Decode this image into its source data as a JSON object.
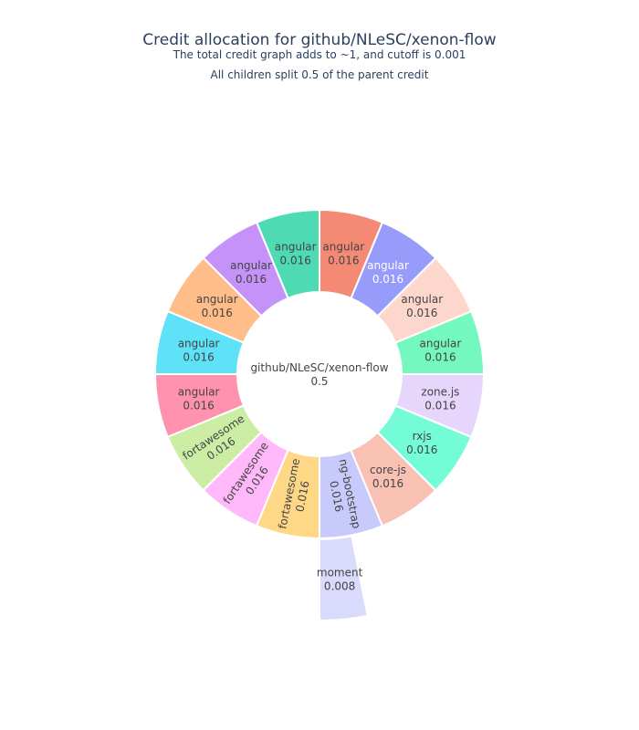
{
  "chart_data": {
    "type": "sunburst",
    "title": "Credit allocation for github/NLeSC/xenon-flow",
    "subtitle_lines": [
      "The total credit graph adds to ~1, and cutoff is 0.001",
      "All children split 0.5 of the parent credit"
    ],
    "root": {
      "label": "github/NLeSC/xenon-flow",
      "value": "0.5"
    },
    "children": [
      {
        "label": "angular",
        "value": "0.016",
        "color": "#F48A74"
      },
      {
        "label": "angular",
        "value": "0.016",
        "color": "#979BF9",
        "text_color": "#ffffff"
      },
      {
        "label": "angular",
        "value": "0.016",
        "color": "#FDD7CC"
      },
      {
        "label": "angular",
        "value": "0.016",
        "color": "#75F7C0"
      },
      {
        "label": "zone.js",
        "value": "0.016",
        "color": "#E7D6FB"
      },
      {
        "label": "rxjs",
        "value": "0.016",
        "color": "#74FCD7"
      },
      {
        "label": "core-js",
        "value": "0.016",
        "color": "#F9C0B4"
      },
      {
        "label": "ng-bootstrap",
        "value": "0.016",
        "color": "#C8CAFB",
        "rotate": true,
        "children": [
          {
            "label": "moment",
            "value": "0.008",
            "color": "#D9DAFC"
          }
        ]
      },
      {
        "label": "fortawesome",
        "value": "0.016",
        "color": "#FED886",
        "rotate": true
      },
      {
        "label": "fortawesome",
        "value": "0.016",
        "color": "#FFB8FA",
        "rotate": true
      },
      {
        "label": "fortawesome",
        "value": "0.016",
        "color": "#CBEDA4",
        "rotate": true
      },
      {
        "label": "angular",
        "value": "0.016",
        "color": "#FF92AE"
      },
      {
        "label": "angular",
        "value": "0.016",
        "color": "#5DE2F7"
      },
      {
        "label": "angular",
        "value": "0.016",
        "color": "#FFBD8A"
      },
      {
        "label": "angular",
        "value": "0.016",
        "color": "#C592F9"
      },
      {
        "label": "angular",
        "value": "0.016",
        "color": "#4EDBB3"
      }
    ]
  }
}
